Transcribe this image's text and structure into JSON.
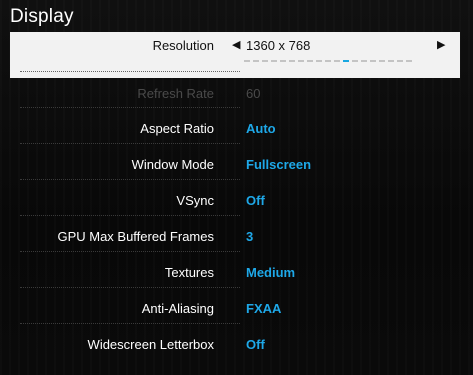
{
  "header": {
    "title": "Display"
  },
  "resolution": {
    "label": "Resolution",
    "value": "1360 x 768",
    "left_arrow": "◀",
    "right_arrow": "▶",
    "option_count": 19,
    "selected_index": 11
  },
  "settings": [
    {
      "label": "Refresh Rate",
      "value": "60",
      "enabled": false
    },
    {
      "label": "Aspect Ratio",
      "value": "Auto",
      "enabled": true
    },
    {
      "label": "Window Mode",
      "value": "Fullscreen",
      "enabled": true
    },
    {
      "label": "VSync",
      "value": "Off",
      "enabled": true
    },
    {
      "label": "GPU Max Buffered Frames",
      "value": "3",
      "enabled": true
    },
    {
      "label": "Textures",
      "value": "Medium",
      "enabled": true
    },
    {
      "label": "Anti-Aliasing",
      "value": "FXAA",
      "enabled": true
    },
    {
      "label": "Widescreen Letterbox",
      "value": "Off",
      "enabled": true
    }
  ],
  "colors": {
    "accent": "#1ea8e8",
    "selected_bg": "#f2f2f2",
    "disabled": "#4a4a4a"
  }
}
